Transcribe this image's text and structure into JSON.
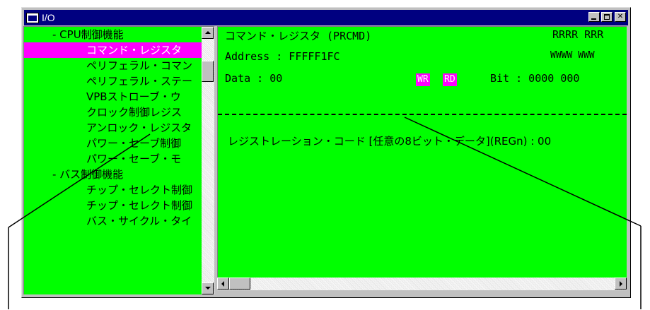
{
  "window": {
    "title": "I/O"
  },
  "tree": {
    "items": [
      {
        "label": "- CPU制御機能",
        "indent": 40,
        "selected": false
      },
      {
        "label": "コマンド・レジスタ",
        "indent": 88,
        "selected": true
      },
      {
        "label": "ペリフェラル・コマン",
        "indent": 88,
        "selected": false
      },
      {
        "label": "ペリフェラル・ステー",
        "indent": 88,
        "selected": false
      },
      {
        "label": "VPBストローブ・ウ",
        "indent": 88,
        "selected": false
      },
      {
        "label": "クロック制御レジス",
        "indent": 88,
        "selected": false
      },
      {
        "label": "アンロック・レジスタ",
        "indent": 88,
        "selected": false
      },
      {
        "label": "パワー・セーブ制御",
        "indent": 88,
        "selected": false
      },
      {
        "label": "パワー・セーブ・モ",
        "indent": 88,
        "selected": false
      },
      {
        "label": "- バス制御機能",
        "indent": 40,
        "selected": false
      },
      {
        "label": "チップ・セレクト制御",
        "indent": 88,
        "selected": false
      },
      {
        "label": "チップ・セレクト制御",
        "indent": 88,
        "selected": false
      },
      {
        "label": "バス・サイクル・タイ",
        "indent": 88,
        "selected": false
      }
    ]
  },
  "detail": {
    "register_name": "コマンド・レジスタ (PRCMD)",
    "address_label": "Address : FFFFF1FC",
    "data_label": "Data    : 00",
    "wr_badge": "WR",
    "rd_badge": "RD",
    "bit_label": "Bit : 0000 000",
    "access_r": "RRRR RRR",
    "access_w": "WWWW WWW",
    "field_line": "レジストレーション・コード [任意の8ビット・データ](REGn) : 00"
  },
  "colors": {
    "pane_bg": "#00ff00",
    "selection": "#ff00ff",
    "title_bar": "#000080"
  }
}
